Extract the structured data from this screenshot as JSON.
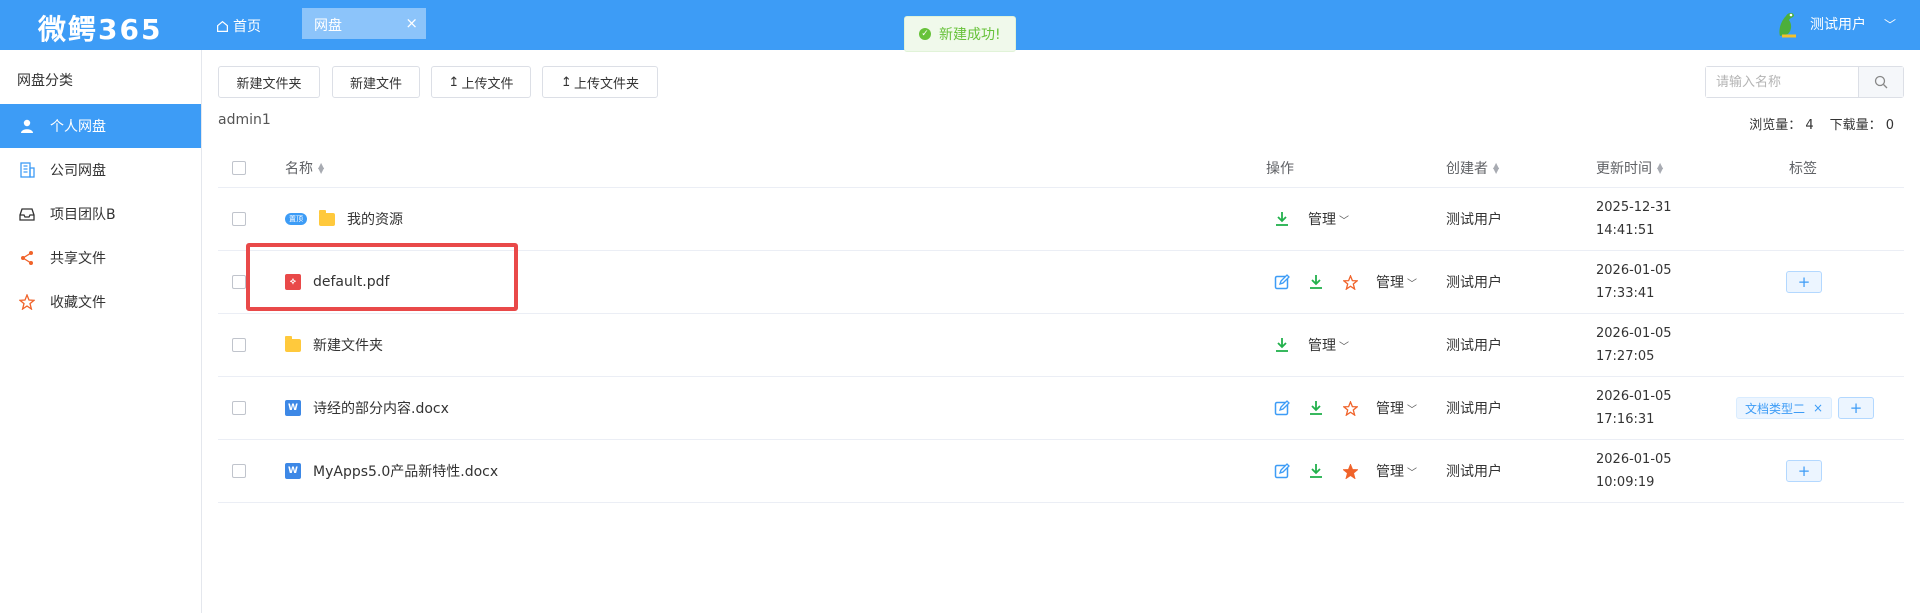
{
  "app": {
    "logo": "微鳄365",
    "home_label": "首页",
    "active_tab": "网盘",
    "tab_close": "×"
  },
  "user": {
    "name": "测试用户",
    "chevron": "﹀"
  },
  "toast": {
    "message": "新建成功!"
  },
  "sidebar": {
    "title": "网盘分类",
    "items": [
      {
        "label": "个人网盘",
        "icon": "user-icon",
        "active": true
      },
      {
        "label": "公司网盘",
        "icon": "building-icon"
      },
      {
        "label": "项目团队B",
        "icon": "inbox-icon"
      },
      {
        "label": "共享文件",
        "icon": "share-icon"
      },
      {
        "label": "收藏文件",
        "icon": "star-icon"
      }
    ]
  },
  "toolbar": {
    "new_folder": "新建文件夹",
    "new_file": "新建文件",
    "upload_file": "上传文件",
    "upload_folder": "上传文件夹",
    "search_placeholder": "请输入名称"
  },
  "path": "admin1",
  "stats": {
    "views": "浏览量： 4",
    "downloads": "下载量： 0"
  },
  "table": {
    "headers": {
      "name": "名称",
      "ops": "操作",
      "creator": "创建者",
      "updated": "更新时间",
      "tags": "标签"
    },
    "rows": [
      {
        "name": "我的资源",
        "type": "folder",
        "badge": "置顶",
        "manage": "管理",
        "creator": "测试用户",
        "date": "2025-12-31",
        "time": "14:41:51",
        "tags": []
      },
      {
        "name": "default.pdf",
        "type": "pdf",
        "manage": "管理",
        "creator": "测试用户",
        "date": "2026-01-05",
        "time": "17:33:41",
        "tags": [],
        "starred": false
      },
      {
        "name": "新建文件夹",
        "type": "folder",
        "manage": "管理",
        "creator": "测试用户",
        "date": "2026-01-05",
        "time": "17:27:05",
        "tags": []
      },
      {
        "name": "诗经的部分内容.docx",
        "type": "docx",
        "manage": "管理",
        "creator": "测试用户",
        "date": "2026-01-05",
        "time": "17:16:31",
        "tags": [
          "文档类型二"
        ],
        "starred": false
      },
      {
        "name": "MyApps5.0产品新特性.docx",
        "type": "docx",
        "manage": "管理",
        "creator": "测试用户",
        "date": "2026-01-05",
        "time": "10:09:19",
        "tags": [],
        "starred": true
      }
    ]
  },
  "colors": {
    "primary": "#3d9cf6",
    "success": "#67c23a",
    "download": "#22b14c",
    "star": "#f0632a",
    "highlight": "#e94949"
  }
}
